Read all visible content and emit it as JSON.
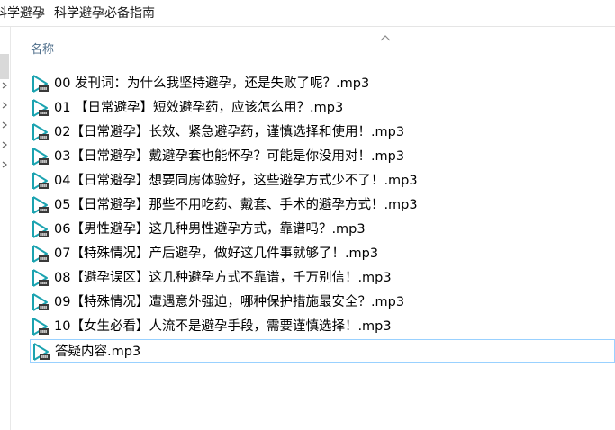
{
  "breadcrumb": {
    "parent": "科学避孕",
    "current": "科学避孕必备指南"
  },
  "columns": {
    "name": "名称"
  },
  "files": [
    {
      "name": "00  发刊词：为什么我坚持避孕，还是失败了呢？.mp3",
      "icon": "audio-file-icon"
    },
    {
      "name": "01 【日常避孕】短效避孕药，应该怎么用？.mp3",
      "icon": "audio-file-icon"
    },
    {
      "name": "02【日常避孕】长效、紧急避孕药，谨慎选择和使用！.mp3",
      "icon": "audio-file-icon"
    },
    {
      "name": "03【日常避孕】戴避孕套也能怀孕？可能是你没用对！.mp3",
      "icon": "audio-file-icon"
    },
    {
      "name": "04【日常避孕】想要同房体验好，这些避孕方式少不了！.mp3",
      "icon": "audio-file-icon"
    },
    {
      "name": "05【日常避孕】那些不用吃药、戴套、手术的避孕方式！.mp3",
      "icon": "audio-file-icon"
    },
    {
      "name": "06【男性避孕】这几种男性避孕方式，靠谱吗？.mp3",
      "icon": "audio-file-icon"
    },
    {
      "name": "07【特殊情况】产后避孕，做好这几件事就够了！.mp3",
      "icon": "audio-file-icon"
    },
    {
      "name": "08【避孕误区】这几种避孕方式不靠谱，千万别信！.mp3",
      "icon": "audio-file-icon"
    },
    {
      "name": "09【特殊情况】遭遇意外强迫，哪种保护措施最安全？.mp3",
      "icon": "audio-file-icon"
    },
    {
      "name": "10【女生必看】人流不是避孕手段，需要谨慎选择！.mp3",
      "icon": "audio-file-icon"
    },
    {
      "name": "答疑内容.mp3",
      "icon": "audio-file-icon",
      "selected": true
    }
  ],
  "colors": {
    "selection_border": "#99d1ff",
    "header_text": "#4d6d8a",
    "icon_teal": "#1ba3b0"
  }
}
